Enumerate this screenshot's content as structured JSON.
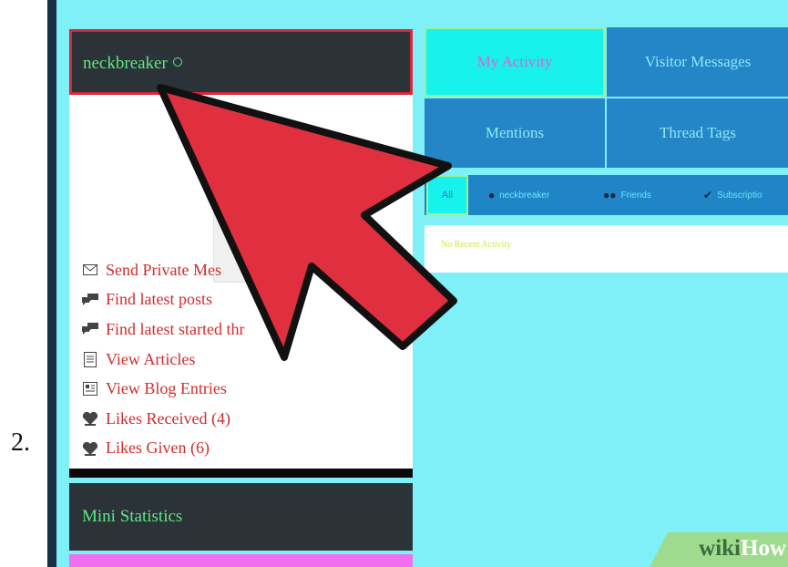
{
  "step_number": "2.",
  "profile": {
    "username": "neckbreaker",
    "links": [
      {
        "icon": "envelope-icon",
        "label": "Send Private Mes"
      },
      {
        "icon": "speech-bubbles-icon",
        "label": "Find latest posts"
      },
      {
        "icon": "speech-bubbles-icon",
        "label": "Find latest started thr"
      },
      {
        "icon": "document-icon",
        "label": "View Articles"
      },
      {
        "icon": "blog-icon",
        "label": "View Blog Entries"
      },
      {
        "icon": "heart-icon",
        "label": "Likes Received (4)"
      },
      {
        "icon": "heart-icon",
        "label": "Likes Given (6)"
      }
    ],
    "mini_stats_title": "Mini Statistics"
  },
  "tabs": [
    {
      "label": "My Activity",
      "active": true
    },
    {
      "label": "Visitor Messages",
      "active": false
    },
    {
      "label": "Mentions",
      "active": false
    },
    {
      "label": "Thread Tags",
      "active": false
    }
  ],
  "subtabs": [
    {
      "label": "All",
      "icon": ""
    },
    {
      "label": "neckbreaker",
      "icon": "user-icon"
    },
    {
      "label": "Friends",
      "icon": "friends-icon"
    },
    {
      "label": "Subscriptio",
      "icon": "check-circle-icon"
    }
  ],
  "activity": {
    "empty_text": "No Recent Activity"
  },
  "watermark": {
    "part1": "wiki",
    "part2": "How"
  },
  "colors": {
    "highlight_border": "#d8263c",
    "arrow_fill": "#e0303f",
    "username_green": "#5ee882",
    "tab_blue": "#2586c7",
    "tab_active": "#17f2ec",
    "page_cyan": "#7ff0f8"
  }
}
